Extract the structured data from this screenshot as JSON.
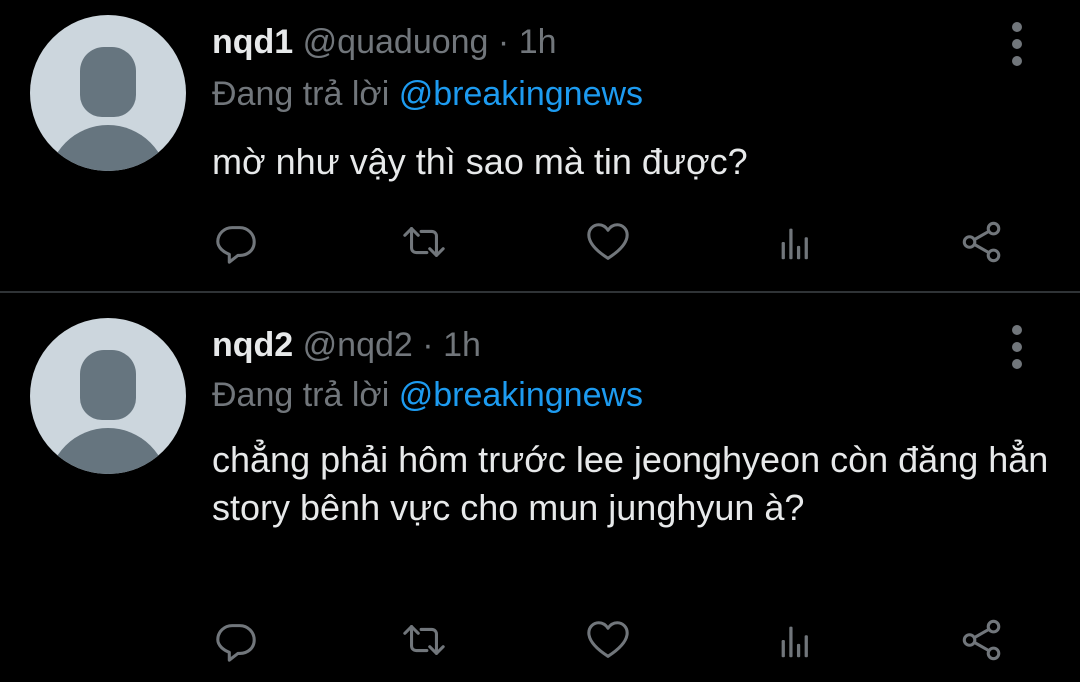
{
  "tweets": [
    {
      "display_name": "nqd1",
      "handle": "@quaduong",
      "separator": "·",
      "time": "1h",
      "reply_prefix": "Đang trả lời",
      "reply_to": "@breakingnews",
      "text": "mờ như vậy thì sao mà tin được?"
    },
    {
      "display_name": "nqd2",
      "handle": "@nqd2",
      "separator": "·",
      "time": "1h",
      "reply_prefix": "Đang trả lời",
      "reply_to": "@breakingnews",
      "text": "chẳng phải hôm trước lee jeonghyeon còn đăng hẳn story bênh vực cho mun junghyun à?"
    }
  ],
  "actions": [
    "reply-icon",
    "retweet-icon",
    "like-icon",
    "views-icon",
    "share-icon"
  ],
  "colors": {
    "background": "#000000",
    "text": "#e7e9ea",
    "secondary": "#71767b",
    "accent": "#1d9bf0",
    "divider": "#2f3336",
    "avatar_bg": "#ccd6dd",
    "avatar_fg": "#66757f"
  }
}
